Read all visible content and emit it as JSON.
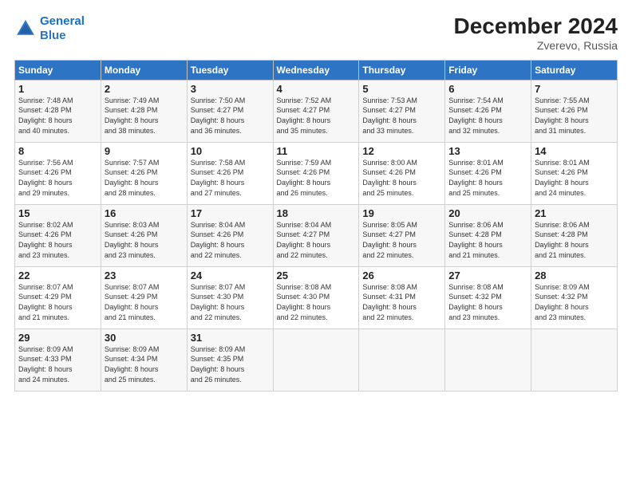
{
  "header": {
    "logo_line1": "General",
    "logo_line2": "Blue",
    "title": "December 2024",
    "subtitle": "Zverevo, Russia"
  },
  "columns": [
    "Sunday",
    "Monday",
    "Tuesday",
    "Wednesday",
    "Thursday",
    "Friday",
    "Saturday"
  ],
  "weeks": [
    [
      {
        "day": "1",
        "info": "Sunrise: 7:48 AM\nSunset: 4:28 PM\nDaylight: 8 hours\nand 40 minutes."
      },
      {
        "day": "2",
        "info": "Sunrise: 7:49 AM\nSunset: 4:28 PM\nDaylight: 8 hours\nand 38 minutes."
      },
      {
        "day": "3",
        "info": "Sunrise: 7:50 AM\nSunset: 4:27 PM\nDaylight: 8 hours\nand 36 minutes."
      },
      {
        "day": "4",
        "info": "Sunrise: 7:52 AM\nSunset: 4:27 PM\nDaylight: 8 hours\nand 35 minutes."
      },
      {
        "day": "5",
        "info": "Sunrise: 7:53 AM\nSunset: 4:27 PM\nDaylight: 8 hours\nand 33 minutes."
      },
      {
        "day": "6",
        "info": "Sunrise: 7:54 AM\nSunset: 4:26 PM\nDaylight: 8 hours\nand 32 minutes."
      },
      {
        "day": "7",
        "info": "Sunrise: 7:55 AM\nSunset: 4:26 PM\nDaylight: 8 hours\nand 31 minutes."
      }
    ],
    [
      {
        "day": "8",
        "info": "Sunrise: 7:56 AM\nSunset: 4:26 PM\nDaylight: 8 hours\nand 29 minutes."
      },
      {
        "day": "9",
        "info": "Sunrise: 7:57 AM\nSunset: 4:26 PM\nDaylight: 8 hours\nand 28 minutes."
      },
      {
        "day": "10",
        "info": "Sunrise: 7:58 AM\nSunset: 4:26 PM\nDaylight: 8 hours\nand 27 minutes."
      },
      {
        "day": "11",
        "info": "Sunrise: 7:59 AM\nSunset: 4:26 PM\nDaylight: 8 hours\nand 26 minutes."
      },
      {
        "day": "12",
        "info": "Sunrise: 8:00 AM\nSunset: 4:26 PM\nDaylight: 8 hours\nand 25 minutes."
      },
      {
        "day": "13",
        "info": "Sunrise: 8:01 AM\nSunset: 4:26 PM\nDaylight: 8 hours\nand 25 minutes."
      },
      {
        "day": "14",
        "info": "Sunrise: 8:01 AM\nSunset: 4:26 PM\nDaylight: 8 hours\nand 24 minutes."
      }
    ],
    [
      {
        "day": "15",
        "info": "Sunrise: 8:02 AM\nSunset: 4:26 PM\nDaylight: 8 hours\nand 23 minutes."
      },
      {
        "day": "16",
        "info": "Sunrise: 8:03 AM\nSunset: 4:26 PM\nDaylight: 8 hours\nand 23 minutes."
      },
      {
        "day": "17",
        "info": "Sunrise: 8:04 AM\nSunset: 4:26 PM\nDaylight: 8 hours\nand 22 minutes."
      },
      {
        "day": "18",
        "info": "Sunrise: 8:04 AM\nSunset: 4:27 PM\nDaylight: 8 hours\nand 22 minutes."
      },
      {
        "day": "19",
        "info": "Sunrise: 8:05 AM\nSunset: 4:27 PM\nDaylight: 8 hours\nand 22 minutes."
      },
      {
        "day": "20",
        "info": "Sunrise: 8:06 AM\nSunset: 4:28 PM\nDaylight: 8 hours\nand 21 minutes."
      },
      {
        "day": "21",
        "info": "Sunrise: 8:06 AM\nSunset: 4:28 PM\nDaylight: 8 hours\nand 21 minutes."
      }
    ],
    [
      {
        "day": "22",
        "info": "Sunrise: 8:07 AM\nSunset: 4:29 PM\nDaylight: 8 hours\nand 21 minutes."
      },
      {
        "day": "23",
        "info": "Sunrise: 8:07 AM\nSunset: 4:29 PM\nDaylight: 8 hours\nand 21 minutes."
      },
      {
        "day": "24",
        "info": "Sunrise: 8:07 AM\nSunset: 4:30 PM\nDaylight: 8 hours\nand 22 minutes."
      },
      {
        "day": "25",
        "info": "Sunrise: 8:08 AM\nSunset: 4:30 PM\nDaylight: 8 hours\nand 22 minutes."
      },
      {
        "day": "26",
        "info": "Sunrise: 8:08 AM\nSunset: 4:31 PM\nDaylight: 8 hours\nand 22 minutes."
      },
      {
        "day": "27",
        "info": "Sunrise: 8:08 AM\nSunset: 4:32 PM\nDaylight: 8 hours\nand 23 minutes."
      },
      {
        "day": "28",
        "info": "Sunrise: 8:09 AM\nSunset: 4:32 PM\nDaylight: 8 hours\nand 23 minutes."
      }
    ],
    [
      {
        "day": "29",
        "info": "Sunrise: 8:09 AM\nSunset: 4:33 PM\nDaylight: 8 hours\nand 24 minutes."
      },
      {
        "day": "30",
        "info": "Sunrise: 8:09 AM\nSunset: 4:34 PM\nDaylight: 8 hours\nand 25 minutes."
      },
      {
        "day": "31",
        "info": "Sunrise: 8:09 AM\nSunset: 4:35 PM\nDaylight: 8 hours\nand 26 minutes."
      },
      {
        "day": "",
        "info": ""
      },
      {
        "day": "",
        "info": ""
      },
      {
        "day": "",
        "info": ""
      },
      {
        "day": "",
        "info": ""
      }
    ]
  ]
}
